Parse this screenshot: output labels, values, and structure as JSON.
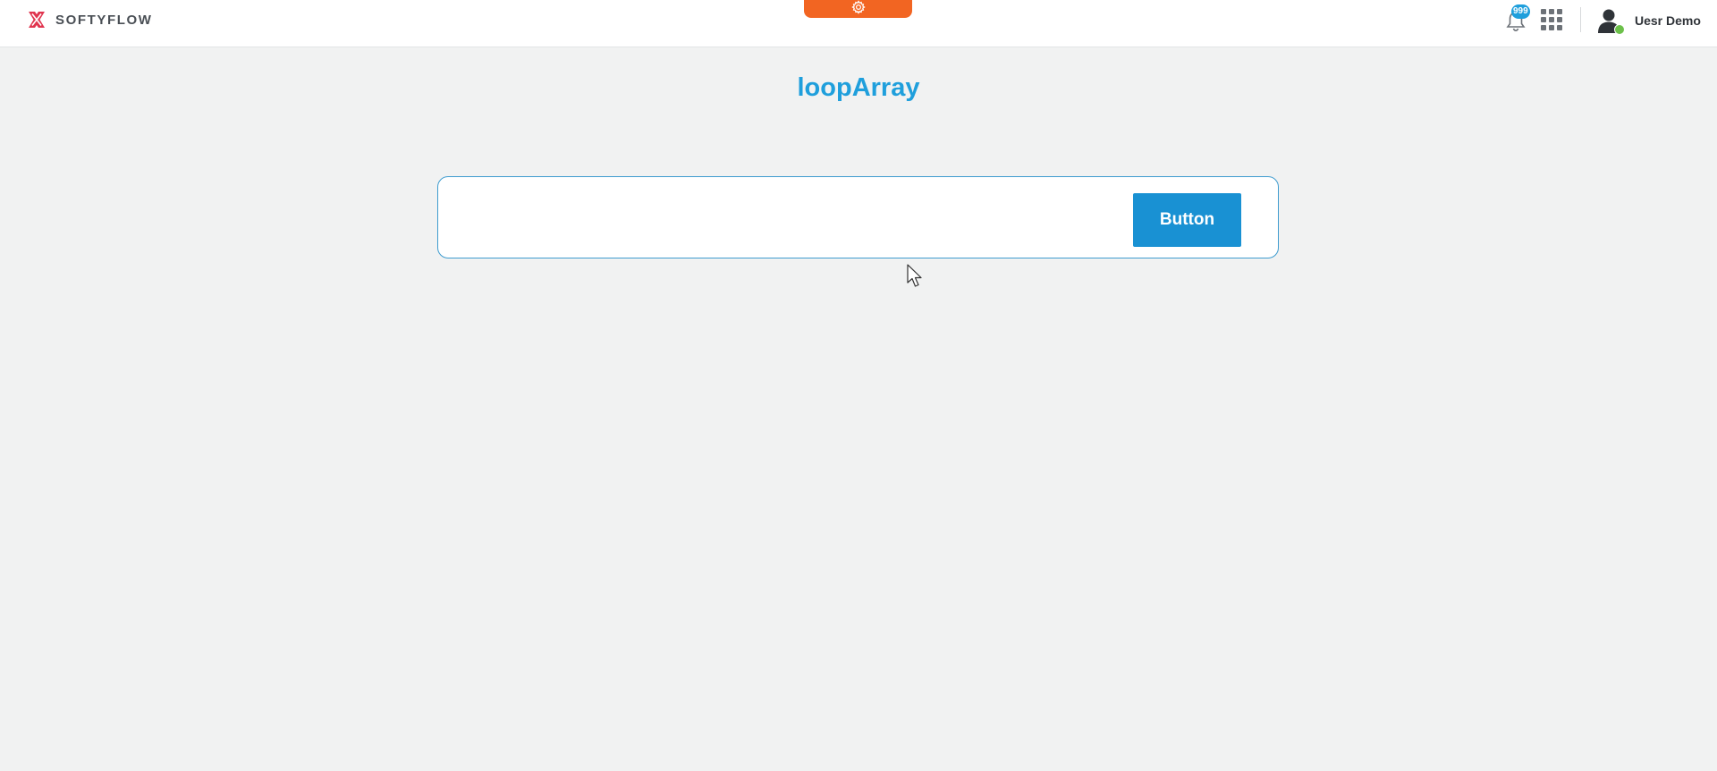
{
  "header": {
    "brand_name": "SOFTYFLOW",
    "notification_count": "999",
    "user_name": "Uesr Demo"
  },
  "icons": {
    "logo": "softyflow-logo-icon",
    "settings": "gear-icon",
    "notifications": "bell-icon",
    "apps": "apps-grid-icon",
    "avatar": "user-avatar-icon",
    "pointer": "mouse-pointer-icon"
  },
  "colors": {
    "accent": "#1f9fdc",
    "button": "#1991d3",
    "settings_tab": "#f26522",
    "online_status": "#6cc04a",
    "logo": "#e0354f"
  },
  "main": {
    "title": "loopArray",
    "button_label": "Button"
  }
}
